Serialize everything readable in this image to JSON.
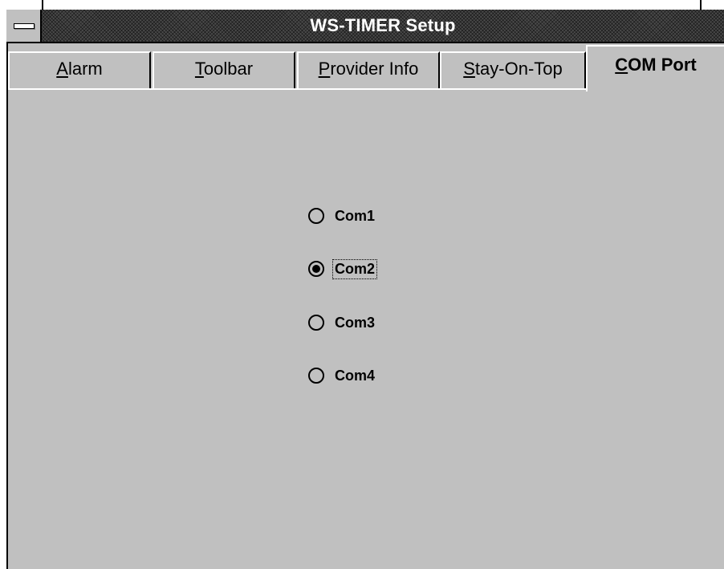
{
  "window": {
    "title": "WS-TIMER Setup"
  },
  "tabs": [
    {
      "label": "Alarm",
      "accel": "A",
      "rest": "larm",
      "active": false
    },
    {
      "label": "Toolbar",
      "accel": "T",
      "rest": "oolbar",
      "active": false
    },
    {
      "label": "Provider Info",
      "accel": "P",
      "rest": "rovider Info",
      "active": false
    },
    {
      "label": "Stay-On-Top",
      "accel": "S",
      "rest": "tay-On-Top",
      "active": false
    },
    {
      "label": "COM Port",
      "accel": "C",
      "rest": "OM Port",
      "active": true
    }
  ],
  "com_port": {
    "options": [
      {
        "label": "Com1",
        "checked": false
      },
      {
        "label": "Com2",
        "checked": true
      },
      {
        "label": "Com3",
        "checked": false
      },
      {
        "label": "Com4",
        "checked": false
      }
    ],
    "selected": "Com2"
  },
  "icons": {
    "system_menu": "system-menu-icon"
  }
}
